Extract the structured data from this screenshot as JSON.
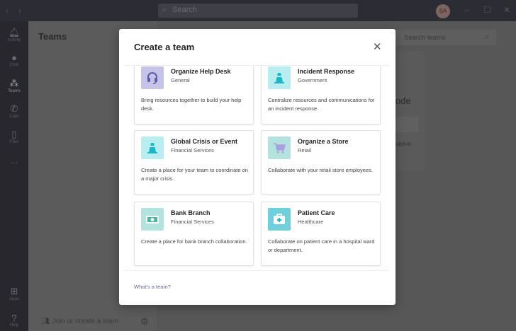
{
  "titlebar": {
    "search_placeholder": "Search",
    "avatar_initials": "SA"
  },
  "rail": [
    {
      "label": "Activity"
    },
    {
      "label": "Chat"
    },
    {
      "label": "Teams"
    },
    {
      "label": "Calls"
    },
    {
      "label": "Files"
    },
    {
      "label": "..."
    },
    {
      "label": "Apps"
    },
    {
      "label": "Help"
    }
  ],
  "teams_panel": {
    "title": "Teams",
    "join_label": "Join or create a team"
  },
  "background": {
    "search_teams_placeholder": "Search teams",
    "code_title_fragment": "ode",
    "code_hint_fragment": "above."
  },
  "modal": {
    "title": "Create a team",
    "footer_link": "What's a team?",
    "templates": [
      {
        "name": "Organize Help Desk",
        "category": "General",
        "description": "Bring resources together to build your help desk.",
        "icon": "headset-icon",
        "color": "#c5c3e8"
      },
      {
        "name": "Incident Response",
        "category": "Government",
        "description": "Centralize resources and communications for an incident response.",
        "icon": "traffic-cone-icon",
        "color": "#b8eef0"
      },
      {
        "name": "Global Crisis or Event",
        "category": "Financial Services",
        "description": "Create a place for your team to coordinate on a major crisis.",
        "icon": "traffic-cone-icon",
        "color": "#b8eef0"
      },
      {
        "name": "Organize a Store",
        "category": "Retail",
        "description": "Collaborate with your retail store employees.",
        "icon": "shopping-cart-icon",
        "color": "#b4e2de"
      },
      {
        "name": "Bank Branch",
        "category": "Financial Services",
        "description": "Create a place for bank branch collaboration.",
        "icon": "banknote-icon",
        "color": "#b4e2de"
      },
      {
        "name": "Patient Care",
        "category": "Healthcare",
        "description": "Collaborate on patient care in a hospital ward or department.",
        "icon": "medical-kit-icon",
        "color": "#6fd0dc"
      }
    ]
  }
}
